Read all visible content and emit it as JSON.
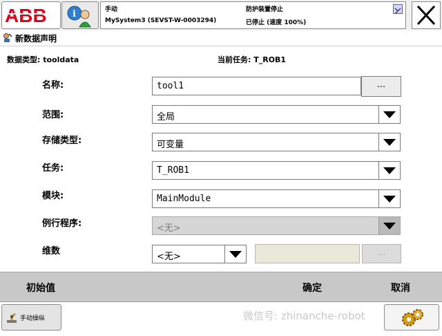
{
  "header": {
    "logo_text": "ABB",
    "mode": "手动",
    "system": "MySystem3 (SEVST-W-0003294)",
    "guard_status": "防护装置停止",
    "run_status": "已停止 (速度 100%)"
  },
  "page": {
    "title": "新数据声明"
  },
  "info": {
    "data_type": "数据类型: tooldata",
    "current_task": "当前任务:  T_ROB1"
  },
  "form": {
    "name_label": "名称:",
    "name_value": "tool1",
    "name_browse_label": "...",
    "scope_label": "范围:",
    "scope_value": "全局",
    "storage_label": "存储类型:",
    "storage_value": "可变量",
    "task_label": "任务:",
    "task_value": "T_ROB1",
    "module_label": "模块:",
    "module_value": "MainModule",
    "routine_label": "例行程序:",
    "routine_value": "<无>",
    "dimension_label": "维数",
    "dimension_value": "<无>",
    "dimension_browse_label": "..."
  },
  "actions": {
    "initial_value": "初始值",
    "ok": "确定",
    "cancel": "取消"
  },
  "footer": {
    "jog_label": "手动操纵",
    "watermark": "微信号: zhinanche-robot"
  },
  "colors": {
    "abb_red": "#e2001a",
    "bar_gray": "#c8c8c8"
  }
}
